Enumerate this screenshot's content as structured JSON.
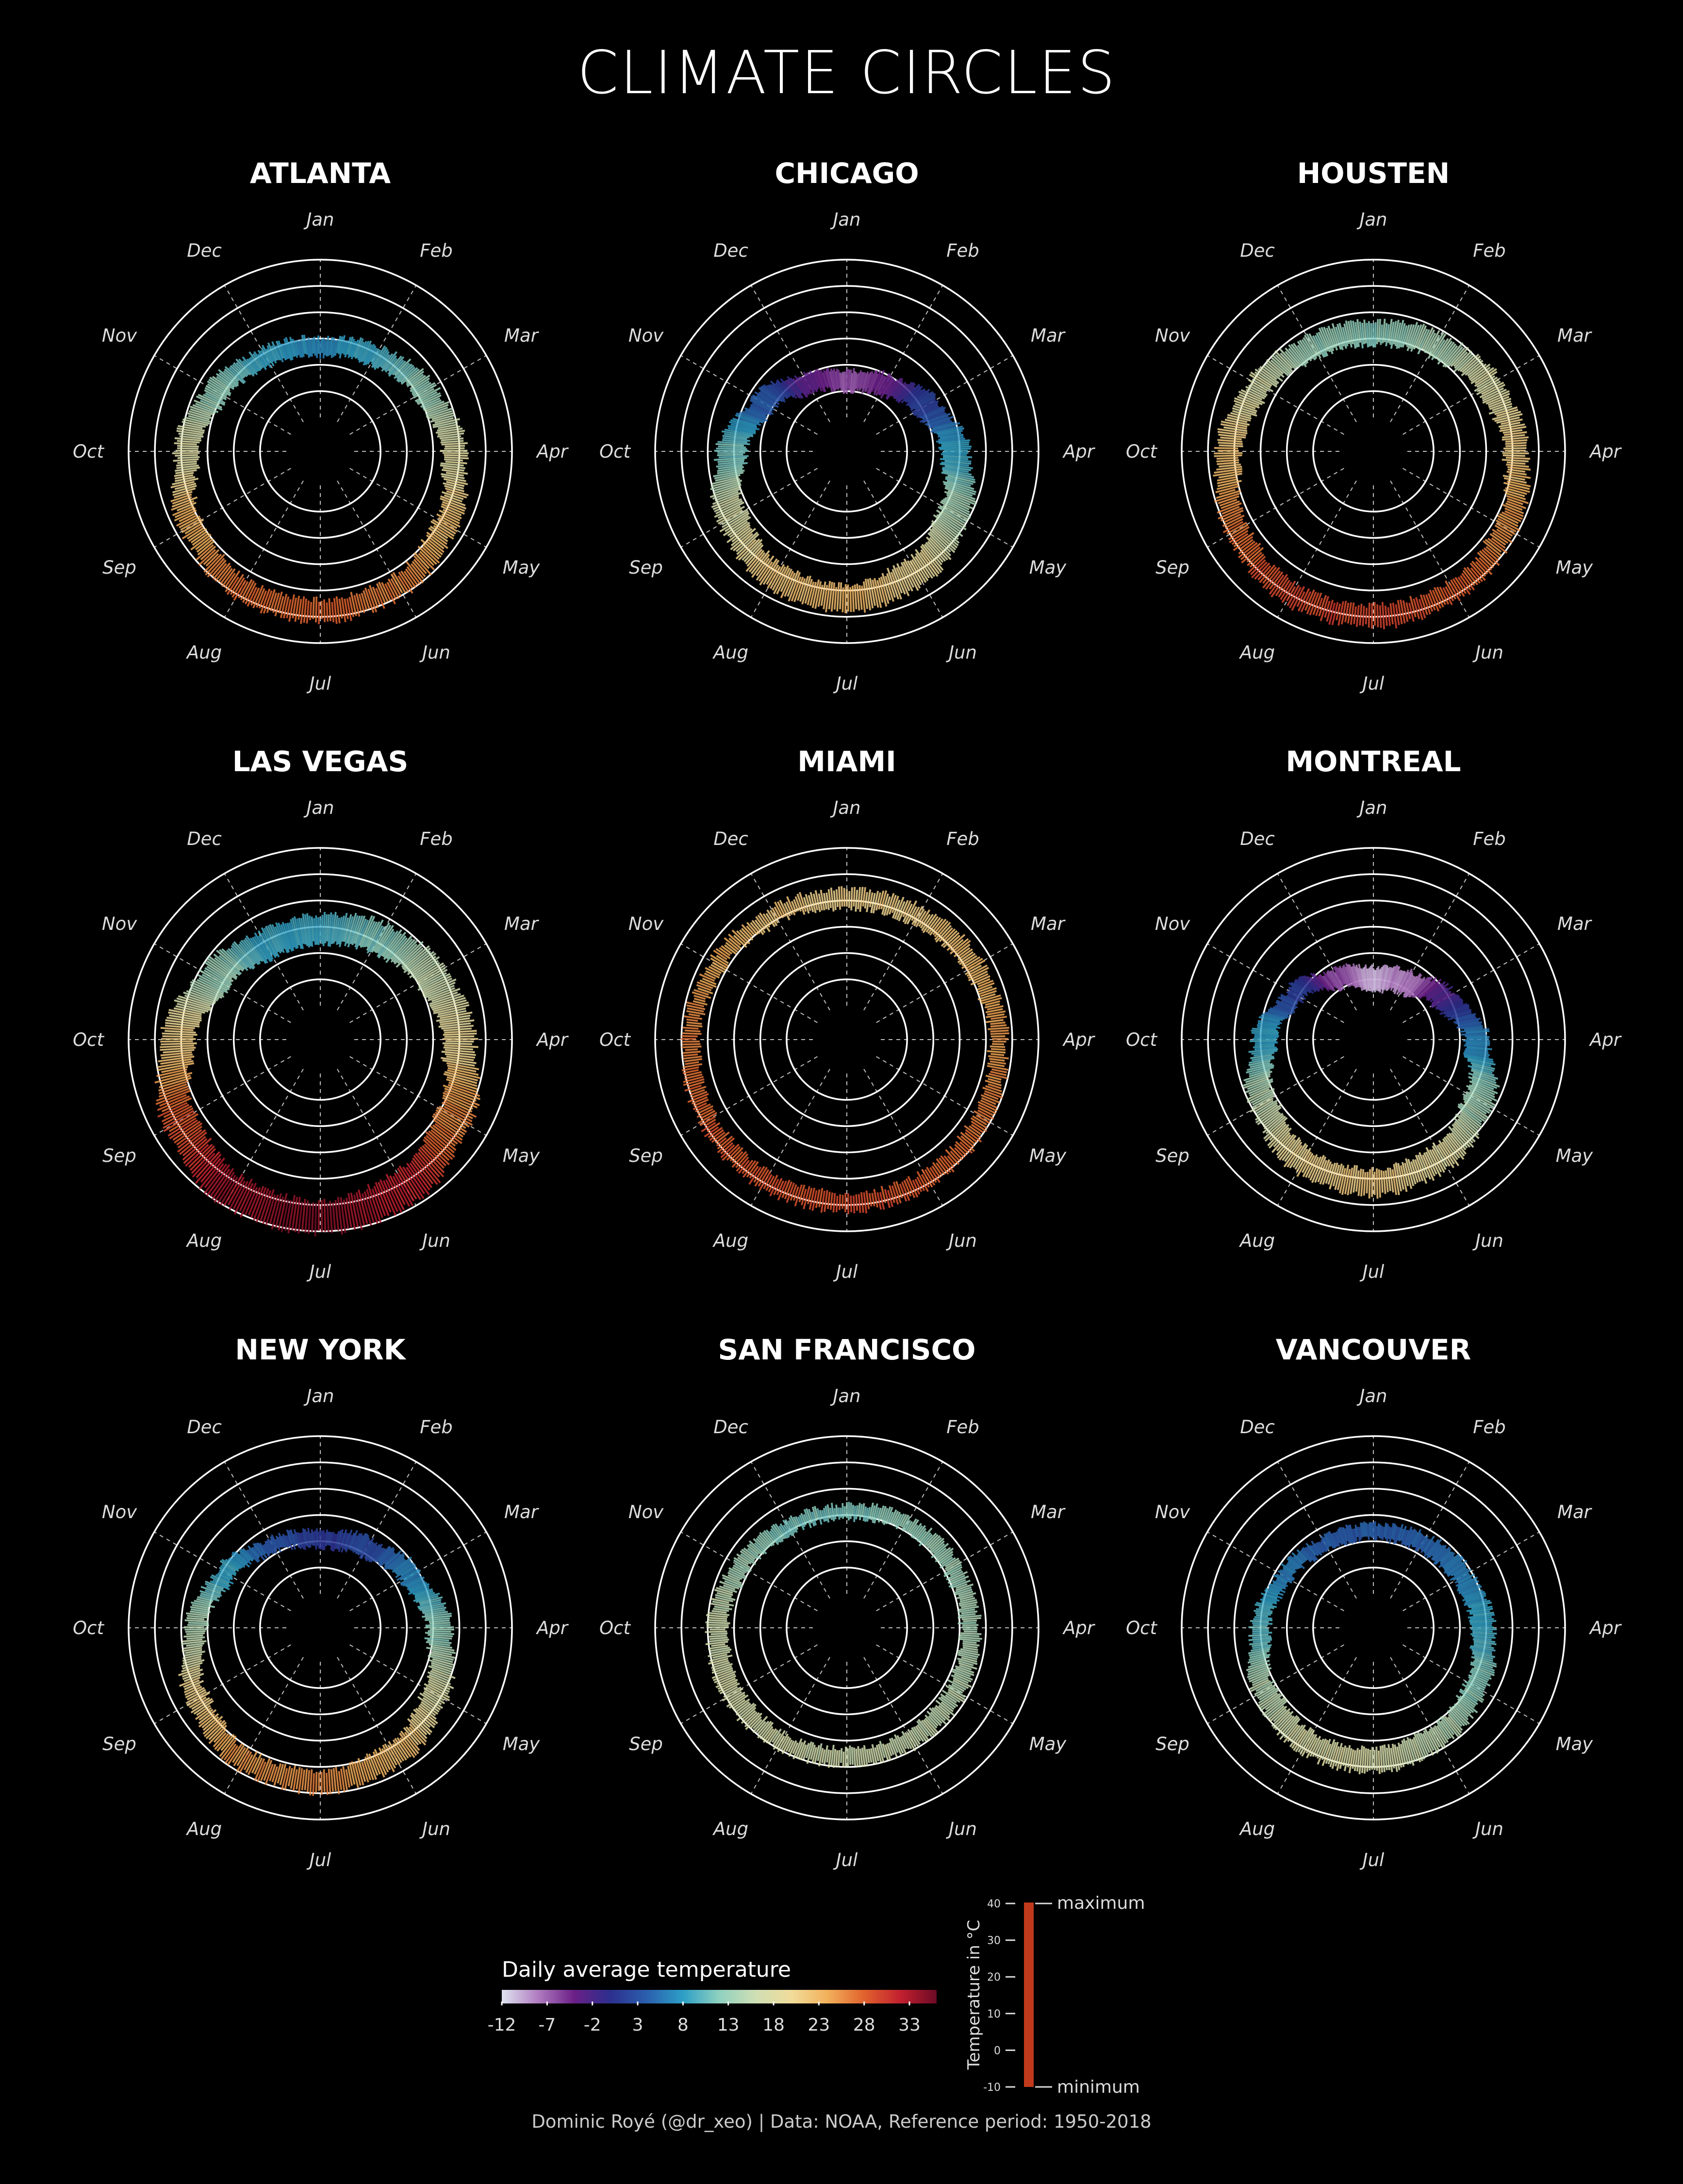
{
  "title": "CLIMATE CIRCLES",
  "months": [
    "Jan",
    "Feb",
    "Mar",
    "Apr",
    "May",
    "Jun",
    "Jul",
    "Aug",
    "Sep",
    "Oct",
    "Nov",
    "Dec"
  ],
  "colors": {
    "background": "#000000",
    "grid": "#ffffff",
    "text": "#ffffff",
    "month_label": "#dddddd",
    "footer": "#cccccc",
    "range_bar": "#c23a1c",
    "palette": [
      "#dfe4f0",
      "#b07cc0",
      "#6a1f86",
      "#2c2f8e",
      "#2b5fae",
      "#2d9fc6",
      "#8fd1c0",
      "#cfdfb4",
      "#f1dc9a",
      "#f2b05a",
      "#e0622d",
      "#c3202f",
      "#6b0a24"
    ]
  },
  "chart_data": {
    "type": "polar-range",
    "units": "°C",
    "cities": [
      {
        "name": "ATLANTA",
        "min": [
          3.5,
          5.0,
          9.0,
          13.5,
          18.0,
          22.0,
          23.5,
          23.0,
          19.5,
          13.5,
          8.0,
          4.5
        ],
        "max": [
          10.5,
          13.0,
          17.5,
          22.5,
          26.5,
          30.5,
          32.0,
          31.5,
          28.0,
          22.5,
          17.0,
          12.0
        ]
      },
      {
        "name": "CHICAGO",
        "min": [
          -10.0,
          -8.0,
          -3.0,
          3.0,
          8.5,
          14.0,
          18.0,
          17.0,
          12.0,
          5.5,
          -1.0,
          -7.0
        ],
        "max": [
          -2.5,
          0.0,
          6.5,
          13.5,
          20.0,
          25.5,
          28.0,
          27.0,
          23.0,
          16.5,
          8.0,
          1.0
        ]
      },
      {
        "name": "HOUSTEN",
        "min": [
          7.5,
          9.0,
          13.0,
          17.0,
          21.5,
          24.5,
          25.5,
          25.5,
          23.0,
          17.5,
          12.5,
          8.5
        ],
        "max": [
          16.5,
          18.5,
          22.5,
          26.0,
          29.5,
          32.5,
          34.0,
          34.0,
          31.0,
          27.0,
          21.5,
          17.5
        ]
      },
      {
        "name": "LAS VEGAS",
        "min": [
          3.5,
          5.5,
          9.5,
          13.5,
          19.5,
          25.0,
          28.5,
          27.0,
          22.5,
          15.0,
          7.5,
          3.0
        ],
        "max": [
          14.5,
          17.5,
          22.0,
          26.0,
          32.5,
          38.5,
          41.0,
          40.0,
          35.0,
          27.5,
          19.5,
          14.0
        ]
      },
      {
        "name": "MIAMI",
        "min": [
          17.0,
          17.5,
          19.5,
          21.5,
          23.5,
          25.0,
          25.5,
          25.5,
          25.0,
          23.5,
          21.0,
          18.5
        ],
        "max": [
          24.5,
          25.0,
          26.5,
          28.0,
          30.0,
          31.5,
          32.5,
          32.5,
          31.5,
          29.5,
          27.0,
          25.0
        ]
      },
      {
        "name": "MONTREAL",
        "min": [
          -14.5,
          -12.5,
          -6.5,
          1.5,
          8.0,
          13.5,
          16.5,
          15.5,
          10.5,
          4.0,
          -2.0,
          -10.0
        ],
        "max": [
          -5.5,
          -3.5,
          2.5,
          11.0,
          19.0,
          24.0,
          26.5,
          25.5,
          20.5,
          13.0,
          5.0,
          -2.5
        ]
      },
      {
        "name": "NEW YORK",
        "min": [
          -2.5,
          -1.5,
          2.5,
          7.5,
          13.0,
          18.5,
          21.5,
          21.0,
          17.0,
          10.5,
          5.0,
          0.5
        ],
        "max": [
          4.0,
          6.0,
          10.5,
          17.0,
          22.5,
          27.5,
          30.0,
          29.0,
          25.0,
          18.5,
          12.0,
          6.0
        ]
      },
      {
        "name": "SAN FRANCISCO",
        "min": [
          8.5,
          9.5,
          10.0,
          10.5,
          11.5,
          12.5,
          13.0,
          13.5,
          13.5,
          12.5,
          10.5,
          8.5
        ],
        "max": [
          14.0,
          15.5,
          16.5,
          17.5,
          18.5,
          19.5,
          19.5,
          20.0,
          21.0,
          20.0,
          17.0,
          14.0
        ]
      },
      {
        "name": "VANCOUVER",
        "min": [
          1.0,
          1.0,
          2.5,
          4.5,
          8.0,
          11.0,
          13.0,
          13.0,
          10.5,
          6.5,
          3.5,
          1.0
        ],
        "max": [
          6.5,
          8.0,
          10.0,
          13.0,
          16.5,
          19.5,
          22.0,
          22.0,
          19.0,
          13.5,
          9.0,
          6.5
        ]
      }
    ],
    "color_legend": {
      "title": "Daily average temperature",
      "ticks": [
        "-12",
        "-7",
        "-2",
        "3",
        "8",
        "13",
        "18",
        "23",
        "28",
        "33"
      ]
    },
    "range_legend": {
      "axis_label": "Temperature in °C",
      "ticks": [
        "40",
        "30",
        "20",
        "10",
        "0",
        "-10"
      ],
      "top_label": "maximum",
      "bottom_label": "minimum"
    }
  },
  "footer": "Dominic Royé (@dr_xeo) | Data: NOAA, Reference period: 1950-2018"
}
